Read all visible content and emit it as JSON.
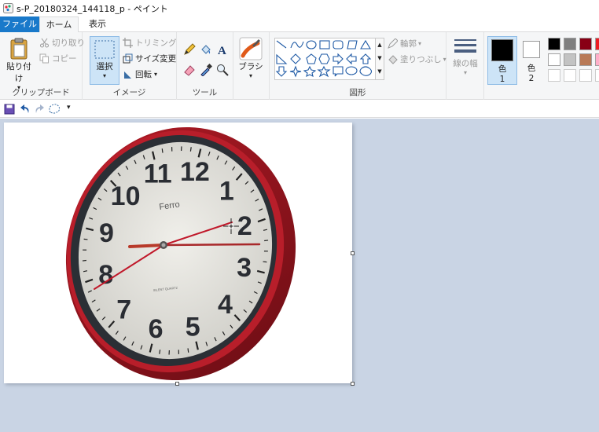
{
  "window": {
    "title": "s-P_20180324_144118_p - ペイント"
  },
  "tabs": {
    "file": "ファイル",
    "home": "ホーム",
    "view": "表示"
  },
  "clipboard": {
    "paste": "貼り付け",
    "cut": "切り取り",
    "copy": "コピー",
    "group_label": "クリップボード"
  },
  "image": {
    "select": "選択",
    "crop": "トリミング",
    "resize": "サイズ変更",
    "rotate": "回転",
    "group_label": "イメージ"
  },
  "tools": {
    "group_label": "ツール",
    "items": [
      "pencil-icon",
      "fill-icon",
      "text-icon",
      "eraser-icon",
      "color-picker-icon",
      "magnifier-icon"
    ]
  },
  "brushes": {
    "label": "ブラシ"
  },
  "shapes": {
    "outline": "輪郭",
    "fill": "塗りつぶし",
    "group_label": "図形"
  },
  "size": {
    "label": "線の幅"
  },
  "colors": {
    "color1_label": "色",
    "color1_num": "1",
    "color2_label": "色",
    "color2_num": "2",
    "color1_value": "#000000",
    "color2_value": "#ffffff",
    "palette": [
      "#000000",
      "#7f7f7f",
      "#880015",
      "#ed1c24",
      "#ffffff",
      "#c3c3c3",
      "#b97a57",
      "#ffaec9",
      "#ffffff",
      "#ffffff",
      "#ffffff",
      "#ffffff"
    ]
  },
  "clock": {
    "brand": "Ferro",
    "movement": "SILENT QUARTZ",
    "numbers": [
      "12",
      "1",
      "2",
      "3",
      "4",
      "5",
      "6",
      "7",
      "8",
      "9",
      "10",
      "11"
    ]
  }
}
